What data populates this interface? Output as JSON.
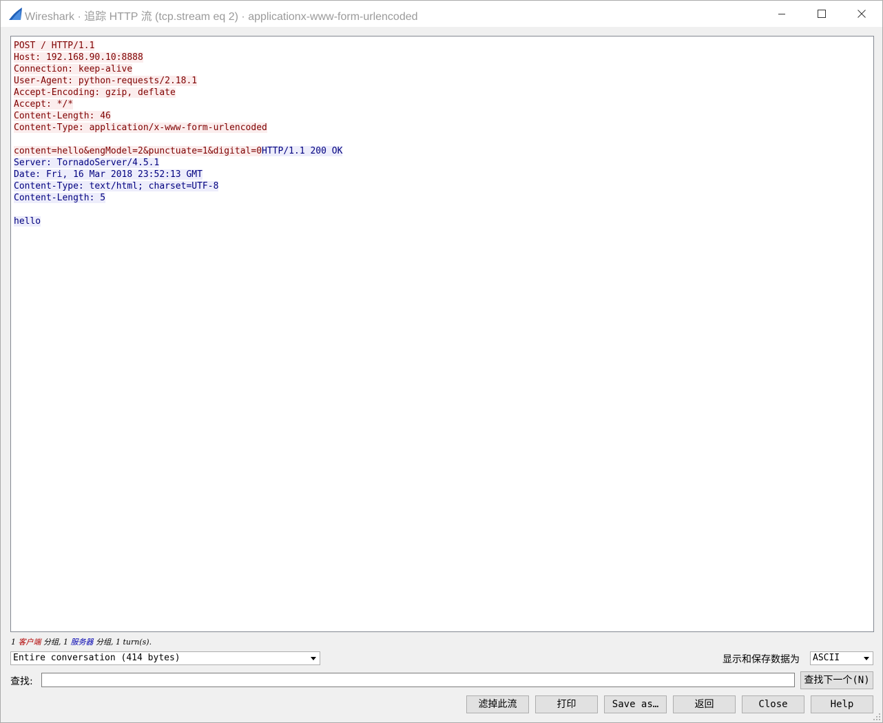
{
  "window": {
    "title": "Wireshark · 追踪 HTTP 流 (tcp.stream eq 2) · applicationx-www-form-urlencoded"
  },
  "stream": {
    "lines": [
      [
        {
          "dir": "client",
          "text": "POST / HTTP/1.1"
        }
      ],
      [
        {
          "dir": "client",
          "text": "Host: 192.168.90.10:8888"
        }
      ],
      [
        {
          "dir": "client",
          "text": "Connection: keep-alive"
        }
      ],
      [
        {
          "dir": "client",
          "text": "User-Agent: python-requests/2.18.1"
        }
      ],
      [
        {
          "dir": "client",
          "text": "Accept-Encoding: gzip, deflate"
        }
      ],
      [
        {
          "dir": "client",
          "text": "Accept: */*"
        }
      ],
      [
        {
          "dir": "client",
          "text": "Content-Length: 46"
        }
      ],
      [
        {
          "dir": "client",
          "text": "Content-Type: application/x-www-form-urlencoded"
        }
      ],
      [],
      [
        {
          "dir": "client",
          "text": "content=hello&engModel=2&punctuate=1&digital=0"
        },
        {
          "dir": "server",
          "text": "HTTP/1.1 200 OK"
        }
      ],
      [
        {
          "dir": "server",
          "text": "Server: TornadoServer/4.5.1"
        }
      ],
      [
        {
          "dir": "server",
          "text": "Date: Fri, 16 Mar 2018 23:52:13 GMT"
        }
      ],
      [
        {
          "dir": "server",
          "text": "Content-Type: text/html; charset=UTF-8"
        }
      ],
      [
        {
          "dir": "server",
          "text": "Content-Length: 5"
        }
      ],
      [],
      [
        {
          "dir": "server",
          "text": "hello"
        }
      ]
    ]
  },
  "stats": {
    "client_count": "1",
    "client_label": "客户端",
    "packets_word_1": "分组,",
    "server_count": "1",
    "server_label": "服务器",
    "packets_word_2": "分组,",
    "turns": "1 turn(s)."
  },
  "conversation_select": {
    "value": "Entire conversation (414 bytes)"
  },
  "encoding": {
    "label": "显示和保存数据为",
    "value": "ASCII"
  },
  "find": {
    "label": "查找:",
    "value": "",
    "next_button": "查找下一个(N)"
  },
  "buttons": {
    "filter_out": "滤掉此流",
    "print": "打印",
    "save_as": "Save as…",
    "back": "返回",
    "close": "Close",
    "help": "Help"
  },
  "colors": {
    "client_text": "#7f0000",
    "client_bg": "#fbeded",
    "server_text": "#00007f",
    "server_bg": "#ededfb"
  }
}
